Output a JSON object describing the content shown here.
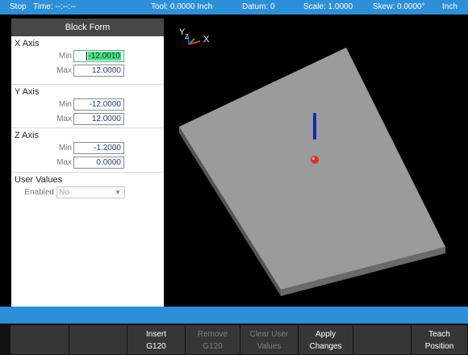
{
  "status": {
    "mode": "Stop",
    "time": "Time:  --:--:--",
    "tool": "Tool: 0.0000 Inch",
    "datum": "Datum: 0",
    "scale": "Scale: 1.0000",
    "skew": "Skew: 0.0000°",
    "units": "Inch"
  },
  "form": {
    "title": "Block Form",
    "x_axis": {
      "title": "X Axis",
      "min_label": "Min",
      "min_value": "-12.0010",
      "max_label": "Max",
      "max_value": "12.0000"
    },
    "y_axis": {
      "title": "Y Axis",
      "min_label": "Min",
      "min_value": "-12.0000",
      "max_label": "Max",
      "max_value": "12.0000"
    },
    "z_axis": {
      "title": "Z Axis",
      "min_label": "Min",
      "min_value": "-1.2000",
      "max_label": "Max",
      "max_value": "0.0000"
    },
    "user_values": {
      "title": "User Values",
      "enabled_label": "Enabled",
      "enabled_value": "No"
    }
  },
  "viewport": {
    "axis_y": "Y",
    "axis_z": "Z",
    "axis_x": "X",
    "colors": {
      "block_top": "#9b9b9b",
      "block_side": "#6a6a6a",
      "tool": "#0b2fa8",
      "marker": "#e0302a"
    }
  },
  "softkeys": {
    "k3_l1": "Insert",
    "k3_l2": "G120",
    "k4_l1": "Remove",
    "k4_l2": "G120",
    "k5_l1": "Clear User",
    "k5_l2": "Values",
    "k6_l1": "Apply",
    "k6_l2": "Changes",
    "k8_l1": "Teach",
    "k8_l2": "Position"
  }
}
